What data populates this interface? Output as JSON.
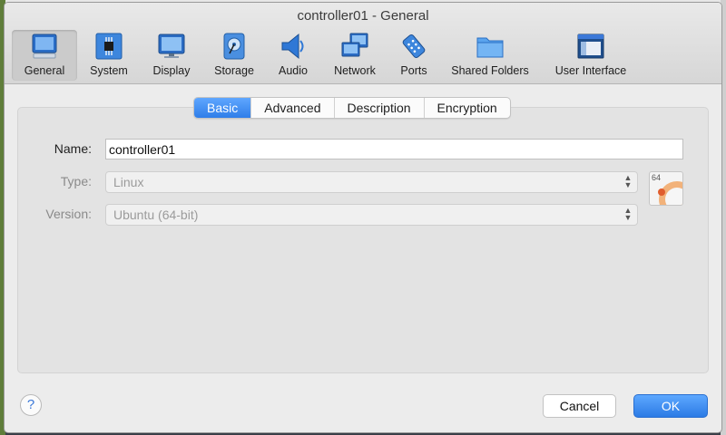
{
  "window": {
    "title": "controller01 - General"
  },
  "toolbar": {
    "items": [
      {
        "label": "General",
        "icon": "general-icon",
        "active": true
      },
      {
        "label": "System",
        "icon": "system-icon"
      },
      {
        "label": "Display",
        "icon": "display-icon"
      },
      {
        "label": "Storage",
        "icon": "storage-icon"
      },
      {
        "label": "Audio",
        "icon": "audio-icon"
      },
      {
        "label": "Network",
        "icon": "network-icon"
      },
      {
        "label": "Ports",
        "icon": "ports-icon"
      },
      {
        "label": "Shared Folders",
        "icon": "shared-folders-icon"
      },
      {
        "label": "User Interface",
        "icon": "user-interface-icon"
      }
    ]
  },
  "tabs": [
    "Basic",
    "Advanced",
    "Description",
    "Encryption"
  ],
  "active_tab": "Basic",
  "form": {
    "name_label": "Name:",
    "name_value": "controller01",
    "type_label": "Type:",
    "type_value": "Linux",
    "version_label": "Version:",
    "version_value": "Ubuntu (64-bit)",
    "os_badge": "64"
  },
  "footer": {
    "help_label": "?",
    "cancel_label": "Cancel",
    "ok_label": "OK"
  },
  "colors": {
    "accent": "#2f7de9",
    "window_bg": "#ececec",
    "panel_bg": "#e3e3e3"
  }
}
